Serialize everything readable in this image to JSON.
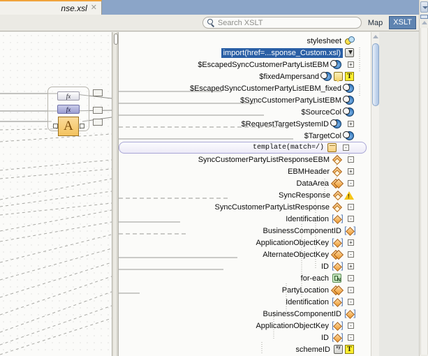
{
  "window": {
    "tab": {
      "label": "nse.xsl",
      "close_icon": "close-icon"
    }
  },
  "toolbar": {
    "search_placeholder": "Search XSLT",
    "search_value": "",
    "search_icon": "search-icon",
    "views": [
      {
        "label": "Map",
        "selected": false
      },
      {
        "label": "XSLT",
        "selected": true
      }
    ]
  },
  "source_canvas": {
    "function_group": {
      "chips": [
        {
          "label": "fx",
          "selected": false
        },
        {
          "label": "fx",
          "selected": true
        }
      ],
      "concat_box": {
        "label": "A",
        "icon": "function-concat-icon"
      }
    }
  },
  "tree": {
    "scrollbar": {
      "up_icon": "scroll-up-icon"
    },
    "rows": [
      {
        "label": "stylesheet",
        "indent": 0,
        "icons": [
          "root-icon"
        ],
        "toggle": null,
        "style": "plain"
      },
      {
        "label": "import(href=...sponse_Custom.xsl)",
        "indent": 1,
        "icons": [
          "import-icon"
        ],
        "toggle": null,
        "style": "selected"
      },
      {
        "label": "$EscapedSyncCustomerPartyListEBM",
        "indent": 1,
        "icons": [
          "variable-icon"
        ],
        "toggle": "+",
        "style": "plain"
      },
      {
        "label": "$fixedAmpersand",
        "indent": 2,
        "icons": [
          "variable-icon",
          "comment-icon",
          "text-icon"
        ],
        "toggle": null,
        "style": "plain"
      },
      {
        "label": "$EscapedSyncCustomerPartyListEBM_fixed",
        "indent": 1,
        "icons": [
          "variable-icon"
        ],
        "toggle": null,
        "style": "plain"
      },
      {
        "label": "$SyncCustomerPartyListEBM",
        "indent": 1,
        "icons": [
          "variable-icon"
        ],
        "toggle": null,
        "style": "plain"
      },
      {
        "label": "$SourceCol",
        "indent": 1,
        "icons": [
          "variable-icon"
        ],
        "toggle": null,
        "style": "plain"
      },
      {
        "label": "$RequestTargetSystemID",
        "indent": 1,
        "icons": [
          "variable-icon"
        ],
        "toggle": "+",
        "style": "plain"
      },
      {
        "label": "$TargetCol",
        "indent": 1,
        "icons": [
          "variable-icon"
        ],
        "toggle": null,
        "style": "plain"
      },
      {
        "label": "template(match=/)",
        "indent": 1,
        "icons": [
          "template-icon"
        ],
        "toggle": "-",
        "style": "band"
      },
      {
        "label": "SyncCustomerPartyListResponseEBM",
        "indent": 2,
        "icons": [
          "element-icon"
        ],
        "toggle": "-",
        "style": "plain"
      },
      {
        "label": "EBMHeader",
        "indent": 3,
        "icons": [
          "element-icon"
        ],
        "toggle": "+",
        "style": "plain"
      },
      {
        "label": "DataArea",
        "indent": 3,
        "icons": [
          "sequence-icon"
        ],
        "toggle": "-",
        "style": "plain"
      },
      {
        "label": "SyncResponse",
        "indent": 4,
        "icons": [
          "element-icon",
          "warning-icon"
        ],
        "toggle": null,
        "style": "plain"
      },
      {
        "label": "SyncCustomerPartyListResponse",
        "indent": 4,
        "icons": [
          "element-icon"
        ],
        "toggle": "-",
        "style": "plain"
      },
      {
        "label": "Identification",
        "indent": 5,
        "icons": [
          "element-bracket-icon"
        ],
        "toggle": "-",
        "style": "plain"
      },
      {
        "label": "BusinessComponentID",
        "indent": 6,
        "icons": [
          "element-bracket-icon"
        ],
        "toggle": null,
        "style": "plain"
      },
      {
        "label": "ApplicationObjectKey",
        "indent": 6,
        "icons": [
          "element-bracket-icon"
        ],
        "toggle": "+",
        "style": "plain"
      },
      {
        "label": "AlternateObjectKey",
        "indent": 6,
        "icons": [
          "sequence-icon"
        ],
        "toggle": "-",
        "style": "plain"
      },
      {
        "label": "ID",
        "indent": 7,
        "icons": [
          "element-bracket-icon"
        ],
        "toggle": "+",
        "style": "plain"
      },
      {
        "label": "for-each",
        "indent": 5,
        "icons": [
          "for-each-icon"
        ],
        "toggle": "-",
        "style": "plain"
      },
      {
        "label": "PartyLocation",
        "indent": 6,
        "icons": [
          "sequence-icon"
        ],
        "toggle": "-",
        "style": "plain"
      },
      {
        "label": "Identification",
        "indent": 7,
        "icons": [
          "element-bracket-icon"
        ],
        "toggle": "-",
        "style": "plain"
      },
      {
        "label": "BusinessComponentID",
        "indent": 8,
        "icons": [
          "element-bracket-icon"
        ],
        "toggle": null,
        "style": "plain"
      },
      {
        "label": "ApplicationObjectKey",
        "indent": 8,
        "icons": [
          "element-bracket-icon"
        ],
        "toggle": "-",
        "style": "plain"
      },
      {
        "label": "ID",
        "indent": 9,
        "icons": [
          "element-bracket-icon"
        ],
        "toggle": "-",
        "style": "plain"
      },
      {
        "label": "schemeID",
        "indent": 10,
        "icons": [
          "attribute-icon",
          "text-icon"
        ],
        "toggle": null,
        "style": "plain"
      }
    ]
  },
  "colors": {
    "tabstrip": "#8ba5c8",
    "selection": "#2a5fa5",
    "view_selected": "#5f84b1",
    "band_border": "#a9a6d6",
    "element_orange": "#ef9a2e",
    "text_icon_yellow": "#ffef2e",
    "warning_yellow": "#f5c518",
    "foreach_green": "#c7e6c0"
  }
}
